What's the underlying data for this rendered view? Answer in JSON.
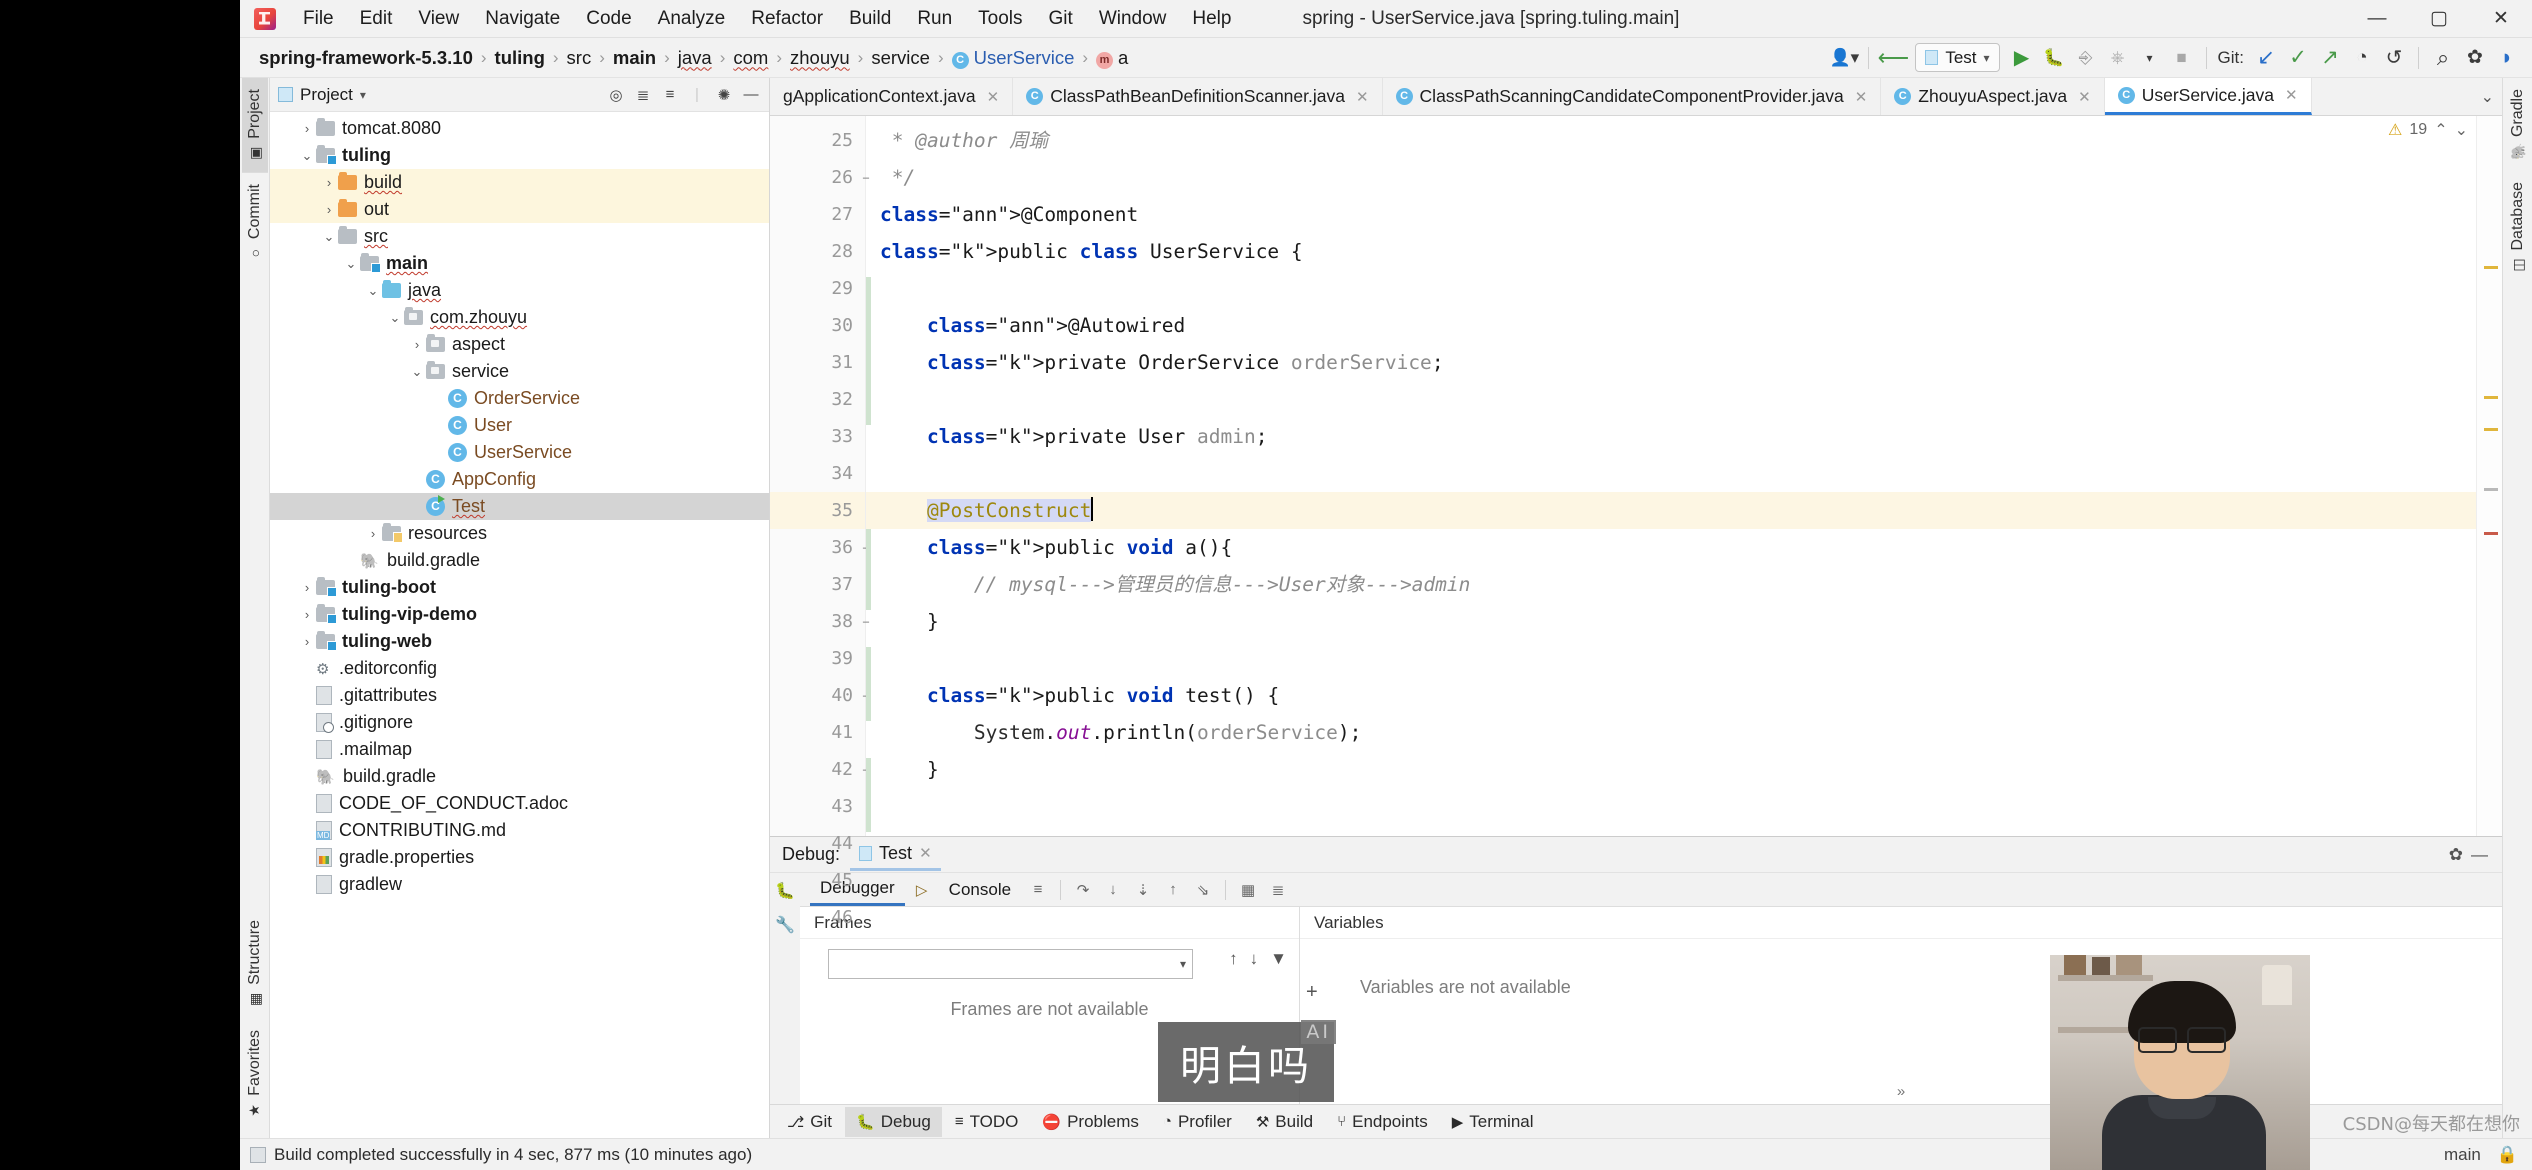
{
  "window": {
    "title": "spring - UserService.java [spring.tuling.main]",
    "minimize": "—",
    "maximize": "▢",
    "close": "✕"
  },
  "menu": [
    "File",
    "Edit",
    "View",
    "Navigate",
    "Code",
    "Analyze",
    "Refactor",
    "Build",
    "Run",
    "Tools",
    "Git",
    "Window",
    "Help"
  ],
  "breadcrumb": [
    {
      "label": "spring-framework-5.3.10",
      "bold": true
    },
    {
      "label": "tuling",
      "bold": true
    },
    {
      "label": "src",
      "bold": false
    },
    {
      "label": "main",
      "bold": true
    },
    {
      "label": "java",
      "bold": false,
      "squiggle": true
    },
    {
      "label": "com",
      "bold": false,
      "squiggle": true
    },
    {
      "label": "zhouyu",
      "bold": false,
      "squiggle": true
    },
    {
      "label": "service",
      "bold": false
    },
    {
      "label": "UserService",
      "bold": false,
      "icon": "class",
      "link": true
    },
    {
      "label": "a",
      "bold": false,
      "icon": "method"
    }
  ],
  "toolbar": {
    "user_icon": "user-settings-icon",
    "back_icon": "back-arrow-icon",
    "run_config": "Test",
    "run_icon": "▶",
    "debug_icon": "debug-bug-icon",
    "coverage_icon": "coverage-icon",
    "profile_icon": "profile-icon",
    "stop_icon": "■",
    "git_label": "Git:",
    "update_icon": "↙",
    "commit_icon": "✓",
    "push_icon": "↗",
    "history_icon": "◔",
    "rollback_icon": "↺",
    "search_icon": "⌕",
    "settings_icon": "✿",
    "theme_icon": "◗"
  },
  "left_strip": {
    "tabs": [
      {
        "label": "Project",
        "icon": "project-icon",
        "active": true
      },
      {
        "label": "Commit",
        "icon": "commit-icon",
        "active": false
      }
    ],
    "bottom_tabs": [
      {
        "label": "Structure",
        "icon": "structure-icon"
      },
      {
        "label": "Favorites",
        "icon": "star-icon"
      }
    ]
  },
  "right_strip": {
    "tabs": [
      {
        "label": "Gradle",
        "icon": "gradle-elephant-icon"
      },
      {
        "label": "Database",
        "icon": "database-icon"
      }
    ]
  },
  "project_panel": {
    "title": "Project",
    "dropdown_icon": "▾",
    "tools": [
      "locate-icon",
      "expand-all-icon",
      "collapse-all-icon",
      "gear-icon",
      "minimize-icon"
    ],
    "tree": [
      {
        "indent": 1,
        "arrow": "›",
        "type": "folder",
        "label": "tomcat.8080",
        "bold": false
      },
      {
        "indent": 1,
        "arrow": "⌄",
        "type": "folder-module",
        "label": "tuling",
        "bold": true
      },
      {
        "indent": 2,
        "arrow": "›",
        "type": "folder-orange",
        "label": "build",
        "bold": false,
        "highlight": "yellow",
        "squiggle": true
      },
      {
        "indent": 2,
        "arrow": "›",
        "type": "folder-orange",
        "label": "out",
        "bold": false,
        "highlight": "yellow"
      },
      {
        "indent": 2,
        "arrow": "⌄",
        "type": "folder",
        "label": "src",
        "bold": false,
        "squiggle": true
      },
      {
        "indent": 3,
        "arrow": "⌄",
        "type": "folder-module",
        "label": "main",
        "bold": true,
        "squiggle": true
      },
      {
        "indent": 4,
        "arrow": "⌄",
        "type": "folder-blue",
        "label": "java",
        "bold": false,
        "squiggle": true
      },
      {
        "indent": 5,
        "arrow": "⌄",
        "type": "folder-pkg",
        "label": "com.zhouyu",
        "bold": false,
        "squiggle": true
      },
      {
        "indent": 6,
        "arrow": "›",
        "type": "folder-pkg",
        "label": "aspect",
        "bold": false
      },
      {
        "indent": 6,
        "arrow": "⌄",
        "type": "folder-pkg",
        "label": "service",
        "bold": false
      },
      {
        "indent": 7,
        "arrow": "",
        "type": "class",
        "label": "OrderService",
        "bold": false
      },
      {
        "indent": 7,
        "arrow": "",
        "type": "class",
        "label": "User",
        "bold": false
      },
      {
        "indent": 7,
        "arrow": "",
        "type": "class",
        "label": "UserService",
        "bold": false
      },
      {
        "indent": 6,
        "arrow": "",
        "type": "class",
        "label": "AppConfig",
        "bold": false
      },
      {
        "indent": 6,
        "arrow": "",
        "type": "class-runnable",
        "label": "Test",
        "bold": false,
        "selected": true,
        "squiggle": true
      },
      {
        "indent": 4,
        "arrow": "›",
        "type": "folder-res",
        "label": "resources",
        "bold": false
      },
      {
        "indent": 3,
        "arrow": "",
        "type": "file-gradle",
        "label": "build.gradle",
        "bold": false
      },
      {
        "indent": 1,
        "arrow": "›",
        "type": "folder-module",
        "label": "tuling-boot",
        "bold": true
      },
      {
        "indent": 1,
        "arrow": "›",
        "type": "folder-module",
        "label": "tuling-vip-demo",
        "bold": true
      },
      {
        "indent": 1,
        "arrow": "›",
        "type": "folder-module",
        "label": "tuling-web",
        "bold": true
      },
      {
        "indent": 1,
        "arrow": "",
        "type": "file-gear",
        "label": ".editorconfig",
        "bold": false
      },
      {
        "indent": 1,
        "arrow": "",
        "type": "file",
        "label": ".gitattributes",
        "bold": false
      },
      {
        "indent": 1,
        "arrow": "",
        "type": "file-gitignore",
        "label": ".gitignore",
        "bold": false
      },
      {
        "indent": 1,
        "arrow": "",
        "type": "file",
        "label": ".mailmap",
        "bold": false
      },
      {
        "indent": 1,
        "arrow": "",
        "type": "file-gradle",
        "label": "build.gradle",
        "bold": false
      },
      {
        "indent": 1,
        "arrow": "",
        "type": "file",
        "label": "CODE_OF_CONDUCT.adoc",
        "bold": false
      },
      {
        "indent": 1,
        "arrow": "",
        "type": "file-md",
        "label": "CONTRIBUTING.md",
        "bold": false
      },
      {
        "indent": 1,
        "arrow": "",
        "type": "file-props",
        "label": "gradle.properties",
        "bold": false
      },
      {
        "indent": 1,
        "arrow": "",
        "type": "file",
        "label": "gradlew",
        "bold": false
      }
    ]
  },
  "editor_tabs": [
    {
      "label": "gApplicationContext.java",
      "icon": "class",
      "active": false,
      "truncated": true
    },
    {
      "label": "ClassPathBeanDefinitionScanner.java",
      "icon": "class",
      "active": false
    },
    {
      "label": "ClassPathScanningCandidateComponentProvider.java",
      "icon": "class",
      "active": false
    },
    {
      "label": "ZhouyuAspect.java",
      "icon": "class",
      "active": false
    },
    {
      "label": "UserService.java",
      "icon": "class",
      "active": true
    }
  ],
  "editor": {
    "warning_count": "19",
    "warning_icon": "warning-triangle-icon",
    "up_icon": "⌃",
    "down_icon": "⌄",
    "lines": [
      {
        "n": "25",
        "fold": "",
        "current": false
      },
      {
        "n": "26",
        "fold": "−",
        "current": false
      },
      {
        "n": "27",
        "fold": "",
        "current": false
      },
      {
        "n": "28",
        "fold": "",
        "current": false
      },
      {
        "n": "29",
        "fold": "",
        "current": false
      },
      {
        "n": "30",
        "fold": "",
        "current": false
      },
      {
        "n": "31",
        "fold": "",
        "current": false
      },
      {
        "n": "32",
        "fold": "",
        "current": false
      },
      {
        "n": "33",
        "fold": "",
        "current": false
      },
      {
        "n": "34",
        "fold": "",
        "current": false
      },
      {
        "n": "35",
        "fold": "",
        "current": true
      },
      {
        "n": "36",
        "fold": "−",
        "current": false
      },
      {
        "n": "37",
        "fold": "",
        "current": false
      },
      {
        "n": "38",
        "fold": "−",
        "current": false
      },
      {
        "n": "39",
        "fold": "",
        "current": false
      },
      {
        "n": "40",
        "fold": "−",
        "current": false
      },
      {
        "n": "41",
        "fold": "",
        "current": false
      },
      {
        "n": "42",
        "fold": "−",
        "current": false
      },
      {
        "n": "43",
        "fold": "",
        "current": false
      },
      {
        "n": "44",
        "fold": "",
        "current": false
      },
      {
        "n": "45",
        "fold": "",
        "current": false
      },
      {
        "n": "46",
        "fold": "",
        "current": false
      }
    ],
    "code_text": [
      " * @author 周瑜",
      " */",
      "@Component",
      "public class UserService {",
      "",
      "    @Autowired",
      "    private OrderService orderService;",
      "",
      "    private User admin;",
      "",
      "    @PostConstruct",
      "    public void a(){",
      "        // mysql--->管理员的信息--->User对象--->admin",
      "    }",
      "",
      "    public void test() {",
      "        System.out.println(orderService);",
      "    }",
      "",
      "",
      "",
      ""
    ]
  },
  "debug_panel": {
    "label": "Debug:",
    "run_tab": "Test",
    "close_icon": "✕",
    "gear_icon": "✿",
    "minimize_icon": "—",
    "side_icons": [
      "debug-bug-icon",
      "wrench-icon"
    ],
    "tabs": [
      {
        "label": "Debugger",
        "active": true
      },
      {
        "label": "Console",
        "active": false,
        "icon": "console-icon"
      }
    ],
    "tool_icons": [
      "layout-icon",
      "step-over-icon",
      "step-into-icon",
      "force-step-into-icon",
      "step-out-icon",
      "run-to-cursor-icon",
      "evaluate-icon",
      "mute-breakpoints-icon"
    ],
    "frames": {
      "header": "Frames",
      "thread_value": "",
      "thread_placeholder": "",
      "dropdown_icon": "▾",
      "up_icon": "↑",
      "down_icon": "↓",
      "filter_icon": "filter-icon",
      "message": "Frames are not available"
    },
    "variables": {
      "header": "Variables",
      "message": "Variables are not available",
      "add_icon": "+",
      "remove_icon": "−",
      "expand_icon": "»"
    }
  },
  "bottom_tabs": [
    {
      "label": "Git",
      "icon": "git-branch-icon",
      "active": false
    },
    {
      "label": "Debug",
      "icon": "debug-bug-icon",
      "active": true
    },
    {
      "label": "TODO",
      "icon": "todo-list-icon",
      "active": false
    },
    {
      "label": "Problems",
      "icon": "problems-error-icon",
      "active": false
    },
    {
      "label": "Profiler",
      "icon": "profiler-icon",
      "active": false
    },
    {
      "label": "Build",
      "icon": "build-hammer-icon",
      "active": false
    },
    {
      "label": "Endpoints",
      "icon": "endpoints-icon",
      "active": false
    },
    {
      "label": "Terminal",
      "icon": "terminal-icon",
      "active": false
    }
  ],
  "status_bar": {
    "message": "Build completed successfully in 4 sec, 877 ms (10 minutes ago)",
    "branch": "main",
    "lock_icon": "lock-icon"
  },
  "overlay": {
    "subtitle": "明白吗",
    "ai_badge": "AI",
    "watermark": "CSDN@每天都在想你"
  }
}
